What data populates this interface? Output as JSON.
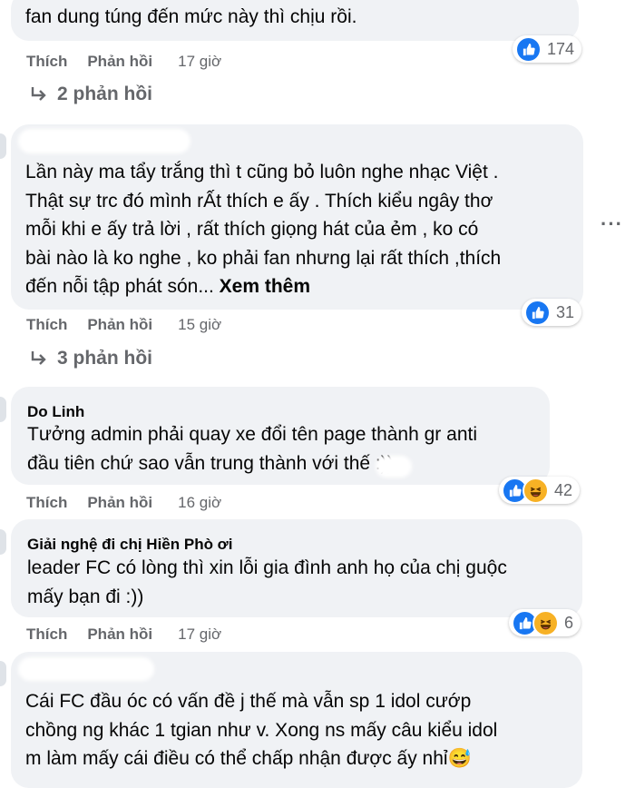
{
  "labels": {
    "like": "Thích",
    "reply": "Phản hồi"
  },
  "comments": [
    {
      "author": "",
      "lines": [
        "fan dung túng đến mức này thì chịu rồi."
      ],
      "more": "",
      "time": "17 giờ",
      "reactions": [
        "like-icon"
      ],
      "count": "174",
      "replies": "2 phản hồi"
    },
    {
      "author": "",
      "lines": [
        "Lần này ma tẩy trắng thì t cũng bỏ luôn nghe nhạc Việt .",
        "Thật sự trc đó mình rẤt thích e ấy . Thích kiểu ngây thơ",
        "mỗi khi e ấy trả lời , rất thích giọng hát của ẻm , ko có",
        "bài nào là ko nghe , ko phải fan nhưng lại rất thích ,thích",
        "đến nỗi tập phát són..."
      ],
      "more": "Xem thêm",
      "time": "15 giờ",
      "reactions": [
        "like-icon"
      ],
      "count": "31",
      "replies": "3 phản hồi"
    },
    {
      "author": "Do Linh",
      "lines": [
        "Tưởng admin phải quay xe đổi tên page thành gr anti",
        "đầu tiên chứ sao vẫn trung thành với        thế :))"
      ],
      "more": "",
      "time": "16 giờ",
      "reactions": [
        "like-icon",
        "haha-icon"
      ],
      "count": "42",
      "replies": ""
    },
    {
      "author": "Giải nghệ đi chị Hiền Phò ơi",
      "lines": [
        "leader FC có lòng thì xin lỗi gia đình anh họ của chị guộc",
        "mấy bạn đi :))"
      ],
      "more": "",
      "time": "17 giờ",
      "reactions": [
        "like-icon",
        "haha-icon"
      ],
      "count": "6",
      "replies": ""
    },
    {
      "author": "",
      "lines": [
        "Cái FC đầu óc có vấn đề j thế mà vẫn sp 1 idol cướp",
        "chồng ng khác 1 tgian như v. Xong ns mấy câu kiểu idol",
        "m làm mấy cái điều có thể chấp nhận được ấy nhỉ😅"
      ],
      "more": "",
      "time": "",
      "reactions": [],
      "count": "",
      "replies": ""
    }
  ],
  "colors": {
    "bubble": "#f0f2f5",
    "like": "#1877f2",
    "haha": "#f7b125",
    "meta": "#65676b"
  }
}
